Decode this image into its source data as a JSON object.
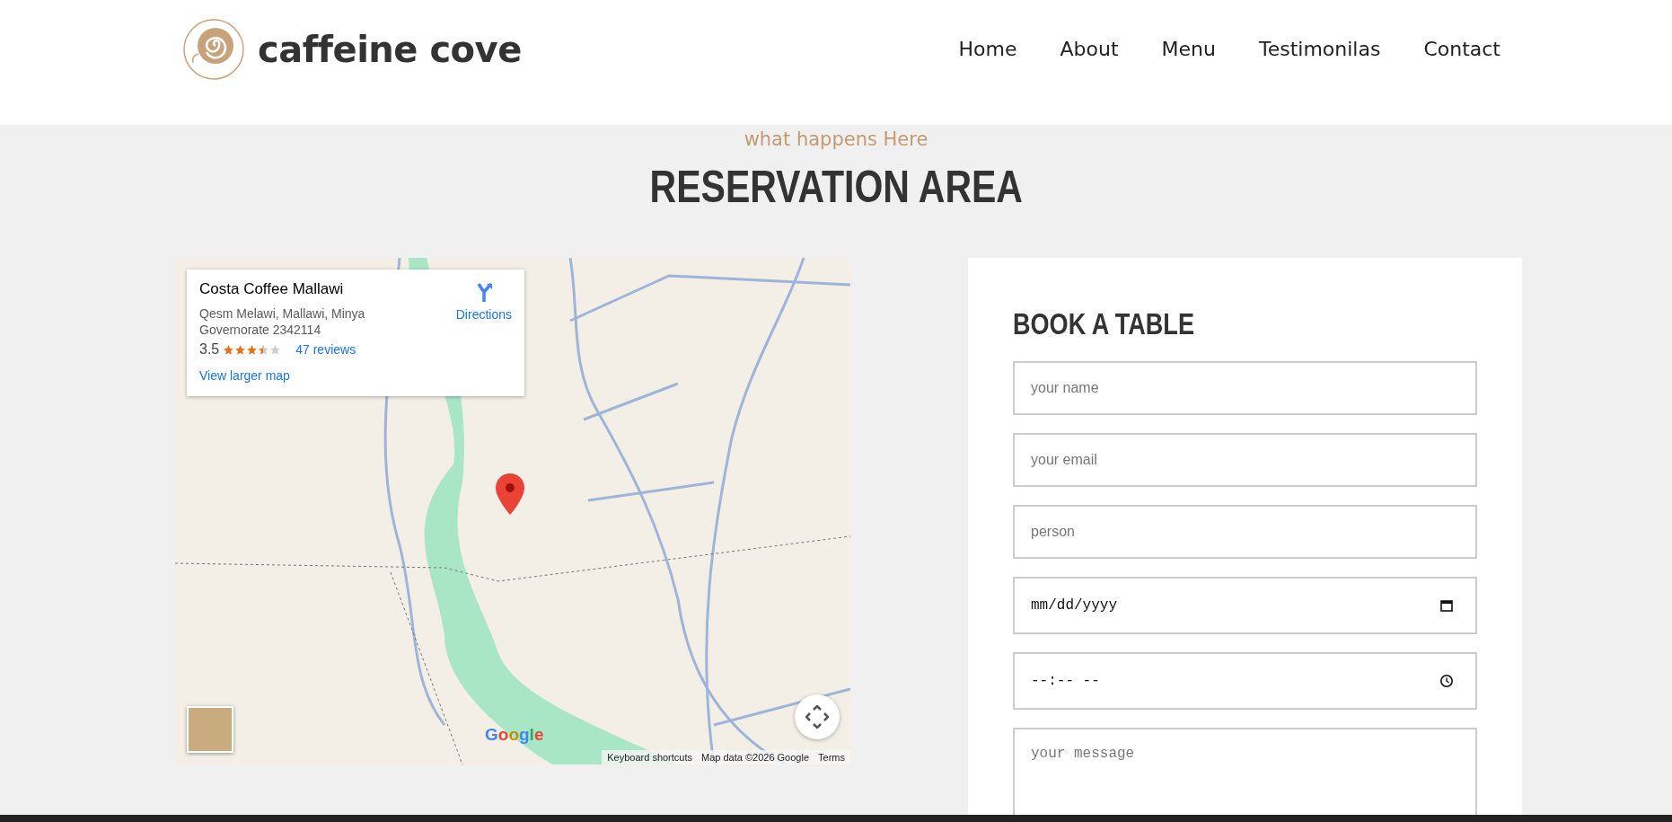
{
  "brand": {
    "name": "caffeine cove"
  },
  "nav": [
    {
      "label": "Home"
    },
    {
      "label": "About"
    },
    {
      "label": "Menu"
    },
    {
      "label": "Testimonilas"
    },
    {
      "label": "Contact"
    }
  ],
  "section": {
    "subtitle": "what happens Here",
    "title": "RESERVATION AREA"
  },
  "map": {
    "place": {
      "name": "Costa Coffee Mallawi",
      "address": "Qesm Melawi, Mallawi, Minya Governorate 2342114",
      "rating": "3.5",
      "stars": 3.5,
      "reviews": "47 reviews",
      "directions": "Directions",
      "larger_map": "View larger map"
    },
    "logo": "Google",
    "attribution": [
      {
        "label": "Keyboard shortcuts"
      },
      {
        "label": "Map data ©2026 Google"
      },
      {
        "label": "Terms"
      }
    ]
  },
  "booking": {
    "title": "BOOK A TABLE",
    "fields": [
      {
        "kind": "text",
        "placeholder": "your name"
      },
      {
        "kind": "text",
        "placeholder": "your email"
      },
      {
        "kind": "text",
        "placeholder": "person"
      },
      {
        "kind": "date",
        "placeholder": "mm/dd/yyyy"
      },
      {
        "kind": "time",
        "placeholder": "--:-- --"
      },
      {
        "kind": "textarea",
        "placeholder": "your message"
      }
    ]
  }
}
